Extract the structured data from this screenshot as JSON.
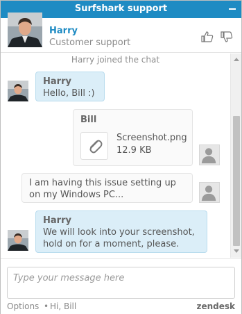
{
  "titlebar": {
    "title": "Surfshark support"
  },
  "agent": {
    "name": "Harry",
    "role": "Customer support"
  },
  "messages": {
    "system_join": "Harry joined the chat",
    "m1": {
      "sender": "Harry",
      "text": "Hello, Bill :)"
    },
    "m2": {
      "sender": "Bill",
      "file_name": "Screenshot.png",
      "file_size": "12.9 KB"
    },
    "m3": {
      "line1": "I am having this issue setting up",
      "line2": "on my Windows PC..."
    },
    "m4": {
      "sender": "Harry",
      "line1": "We will look into your screenshot,",
      "line2": "hold on for a moment, please."
    }
  },
  "composer": {
    "placeholder": "Type your message here"
  },
  "footer": {
    "options": "Options",
    "separator": "•",
    "greeting": "Hi, Bill",
    "brand": "zendesk"
  },
  "colors": {
    "accent": "#1e8bc3",
    "agent_bubble": "#dbeef8",
    "visitor_bubble": "#fafafa"
  },
  "icons": {
    "minimize": "minus-icon",
    "rate_good": "thumbs-up-icon",
    "rate_bad": "thumbs-down-icon",
    "attachment": "paperclip-icon",
    "visitor": "user-silhouette-icon"
  }
}
